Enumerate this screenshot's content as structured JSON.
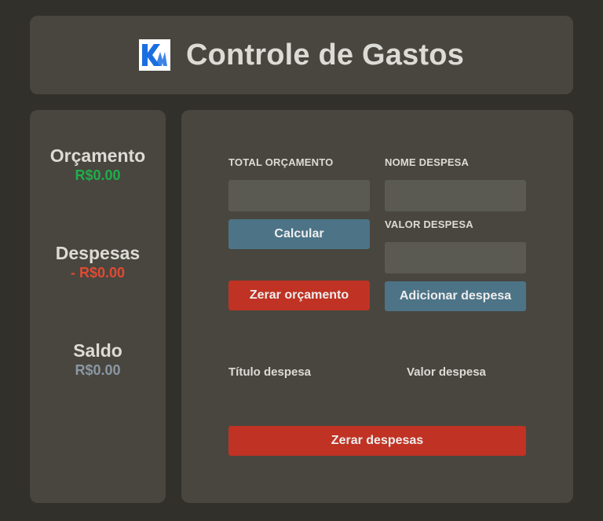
{
  "header": {
    "title": "Controle de Gastos",
    "logo_icon": "km-logo-icon"
  },
  "summary": {
    "budget_label": "Orçamento",
    "budget_value": "R$0.00",
    "expenses_label": "Despesas",
    "expenses_value": "- R$0.00",
    "balance_label": "Saldo",
    "balance_value": "R$0.00"
  },
  "form": {
    "total_budget_label": "TOTAL ORÇAMENTO",
    "total_budget_value": "",
    "expense_name_label": "NOME DESPESA",
    "expense_name_value": "",
    "expense_value_label": "VALOR DESPESA",
    "expense_value_value": "",
    "calculate_button": "Calcular",
    "reset_budget_button": "Zerar orçamento",
    "add_expense_button": "Adicionar despesa"
  },
  "expense_table": {
    "columns": [
      "Título despesa",
      "Valor despesa"
    ],
    "rows": []
  },
  "reset_expenses_button": "Zerar despesas",
  "colors": {
    "background": "#31302b",
    "card": "#48463f",
    "input": "#5a5952",
    "positive": "#1fae4a",
    "negative": "#e04a33",
    "neutral": "#8b97a3",
    "button_blue": "#4d7386",
    "button_red": "#c03223"
  }
}
